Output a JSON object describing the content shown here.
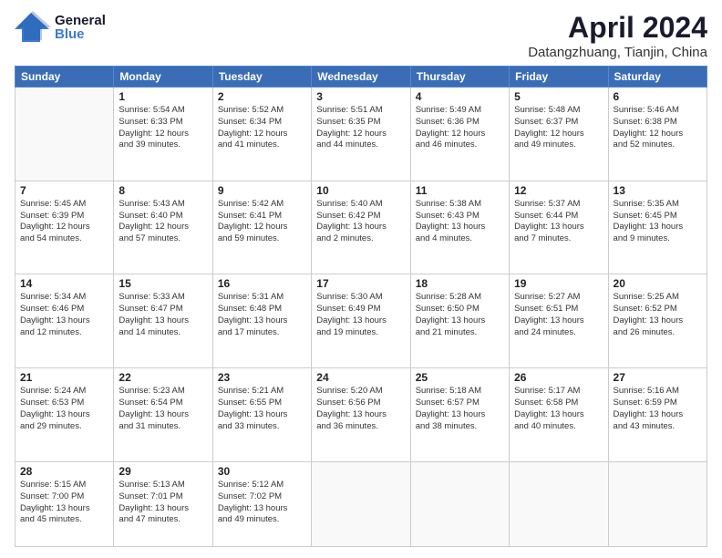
{
  "header": {
    "logo_general": "General",
    "logo_blue": "Blue",
    "title": "April 2024",
    "subtitle": "Datangzhuang, Tianjin, China"
  },
  "weekdays": [
    "Sunday",
    "Monday",
    "Tuesday",
    "Wednesday",
    "Thursday",
    "Friday",
    "Saturday"
  ],
  "weeks": [
    [
      {
        "day": "",
        "sunrise": "",
        "sunset": "",
        "daylight": ""
      },
      {
        "day": "1",
        "sunrise": "Sunrise: 5:54 AM",
        "sunset": "Sunset: 6:33 PM",
        "daylight": "Daylight: 12 hours and 39 minutes."
      },
      {
        "day": "2",
        "sunrise": "Sunrise: 5:52 AM",
        "sunset": "Sunset: 6:34 PM",
        "daylight": "Daylight: 12 hours and 41 minutes."
      },
      {
        "day": "3",
        "sunrise": "Sunrise: 5:51 AM",
        "sunset": "Sunset: 6:35 PM",
        "daylight": "Daylight: 12 hours and 44 minutes."
      },
      {
        "day": "4",
        "sunrise": "Sunrise: 5:49 AM",
        "sunset": "Sunset: 6:36 PM",
        "daylight": "Daylight: 12 hours and 46 minutes."
      },
      {
        "day": "5",
        "sunrise": "Sunrise: 5:48 AM",
        "sunset": "Sunset: 6:37 PM",
        "daylight": "Daylight: 12 hours and 49 minutes."
      },
      {
        "day": "6",
        "sunrise": "Sunrise: 5:46 AM",
        "sunset": "Sunset: 6:38 PM",
        "daylight": "Daylight: 12 hours and 52 minutes."
      }
    ],
    [
      {
        "day": "7",
        "sunrise": "Sunrise: 5:45 AM",
        "sunset": "Sunset: 6:39 PM",
        "daylight": "Daylight: 12 hours and 54 minutes."
      },
      {
        "day": "8",
        "sunrise": "Sunrise: 5:43 AM",
        "sunset": "Sunset: 6:40 PM",
        "daylight": "Daylight: 12 hours and 57 minutes."
      },
      {
        "day": "9",
        "sunrise": "Sunrise: 5:42 AM",
        "sunset": "Sunset: 6:41 PM",
        "daylight": "Daylight: 12 hours and 59 minutes."
      },
      {
        "day": "10",
        "sunrise": "Sunrise: 5:40 AM",
        "sunset": "Sunset: 6:42 PM",
        "daylight": "Daylight: 13 hours and 2 minutes."
      },
      {
        "day": "11",
        "sunrise": "Sunrise: 5:38 AM",
        "sunset": "Sunset: 6:43 PM",
        "daylight": "Daylight: 13 hours and 4 minutes."
      },
      {
        "day": "12",
        "sunrise": "Sunrise: 5:37 AM",
        "sunset": "Sunset: 6:44 PM",
        "daylight": "Daylight: 13 hours and 7 minutes."
      },
      {
        "day": "13",
        "sunrise": "Sunrise: 5:35 AM",
        "sunset": "Sunset: 6:45 PM",
        "daylight": "Daylight: 13 hours and 9 minutes."
      }
    ],
    [
      {
        "day": "14",
        "sunrise": "Sunrise: 5:34 AM",
        "sunset": "Sunset: 6:46 PM",
        "daylight": "Daylight: 13 hours and 12 minutes."
      },
      {
        "day": "15",
        "sunrise": "Sunrise: 5:33 AM",
        "sunset": "Sunset: 6:47 PM",
        "daylight": "Daylight: 13 hours and 14 minutes."
      },
      {
        "day": "16",
        "sunrise": "Sunrise: 5:31 AM",
        "sunset": "Sunset: 6:48 PM",
        "daylight": "Daylight: 13 hours and 17 minutes."
      },
      {
        "day": "17",
        "sunrise": "Sunrise: 5:30 AM",
        "sunset": "Sunset: 6:49 PM",
        "daylight": "Daylight: 13 hours and 19 minutes."
      },
      {
        "day": "18",
        "sunrise": "Sunrise: 5:28 AM",
        "sunset": "Sunset: 6:50 PM",
        "daylight": "Daylight: 13 hours and 21 minutes."
      },
      {
        "day": "19",
        "sunrise": "Sunrise: 5:27 AM",
        "sunset": "Sunset: 6:51 PM",
        "daylight": "Daylight: 13 hours and 24 minutes."
      },
      {
        "day": "20",
        "sunrise": "Sunrise: 5:25 AM",
        "sunset": "Sunset: 6:52 PM",
        "daylight": "Daylight: 13 hours and 26 minutes."
      }
    ],
    [
      {
        "day": "21",
        "sunrise": "Sunrise: 5:24 AM",
        "sunset": "Sunset: 6:53 PM",
        "daylight": "Daylight: 13 hours and 29 minutes."
      },
      {
        "day": "22",
        "sunrise": "Sunrise: 5:23 AM",
        "sunset": "Sunset: 6:54 PM",
        "daylight": "Daylight: 13 hours and 31 minutes."
      },
      {
        "day": "23",
        "sunrise": "Sunrise: 5:21 AM",
        "sunset": "Sunset: 6:55 PM",
        "daylight": "Daylight: 13 hours and 33 minutes."
      },
      {
        "day": "24",
        "sunrise": "Sunrise: 5:20 AM",
        "sunset": "Sunset: 6:56 PM",
        "daylight": "Daylight: 13 hours and 36 minutes."
      },
      {
        "day": "25",
        "sunrise": "Sunrise: 5:18 AM",
        "sunset": "Sunset: 6:57 PM",
        "daylight": "Daylight: 13 hours and 38 minutes."
      },
      {
        "day": "26",
        "sunrise": "Sunrise: 5:17 AM",
        "sunset": "Sunset: 6:58 PM",
        "daylight": "Daylight: 13 hours and 40 minutes."
      },
      {
        "day": "27",
        "sunrise": "Sunrise: 5:16 AM",
        "sunset": "Sunset: 6:59 PM",
        "daylight": "Daylight: 13 hours and 43 minutes."
      }
    ],
    [
      {
        "day": "28",
        "sunrise": "Sunrise: 5:15 AM",
        "sunset": "Sunset: 7:00 PM",
        "daylight": "Daylight: 13 hours and 45 minutes."
      },
      {
        "day": "29",
        "sunrise": "Sunrise: 5:13 AM",
        "sunset": "Sunset: 7:01 PM",
        "daylight": "Daylight: 13 hours and 47 minutes."
      },
      {
        "day": "30",
        "sunrise": "Sunrise: 5:12 AM",
        "sunset": "Sunset: 7:02 PM",
        "daylight": "Daylight: 13 hours and 49 minutes."
      },
      {
        "day": "",
        "sunrise": "",
        "sunset": "",
        "daylight": ""
      },
      {
        "day": "",
        "sunrise": "",
        "sunset": "",
        "daylight": ""
      },
      {
        "day": "",
        "sunrise": "",
        "sunset": "",
        "daylight": ""
      },
      {
        "day": "",
        "sunrise": "",
        "sunset": "",
        "daylight": ""
      }
    ]
  ]
}
